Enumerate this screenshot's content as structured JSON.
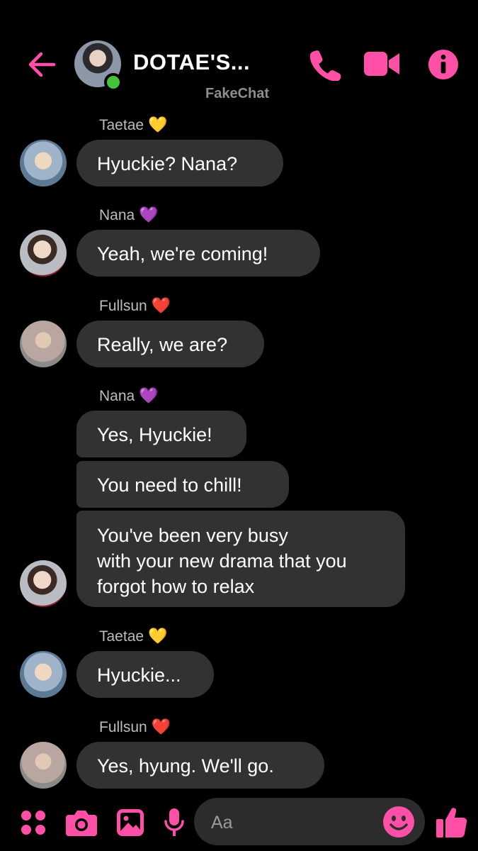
{
  "accent": "#ff4fa7",
  "header": {
    "title": "DOTAE'S...",
    "watermark": "FakeChat",
    "online": true,
    "icons": [
      "back-arrow-icon",
      "phone-icon",
      "video-camera-icon",
      "info-icon"
    ]
  },
  "messages": [
    {
      "sender": "Taetae",
      "heart": "💛",
      "bubbles": [
        "Hyuckie?  Nana?"
      ]
    },
    {
      "sender": "Nana",
      "heart": "💜",
      "bubbles": [
        "Yeah,  we're coming!"
      ]
    },
    {
      "sender": "Fullsun",
      "heart": "❤️",
      "bubbles": [
        "Really, we are?"
      ]
    },
    {
      "sender": "Nana",
      "heart": "💜",
      "bubbles": [
        "Yes, Hyuckie!",
        "You need to chill!",
        "You've been very busy\nwith your new drama that you\nforgot how to relax"
      ]
    },
    {
      "sender": "Taetae",
      "heart": "💛",
      "bubbles": [
        "Hyuckie..."
      ]
    },
    {
      "sender": "Fullsun",
      "heart": "❤️",
      "bubbles": [
        "Yes,  hyung. We'll go."
      ]
    }
  ],
  "composer": {
    "placeholder": "Aa",
    "icons": [
      "apps-grid-icon",
      "camera-icon",
      "gallery-image-icon",
      "microphone-icon",
      "emoji-icon",
      "thumbs-up-icon"
    ]
  }
}
